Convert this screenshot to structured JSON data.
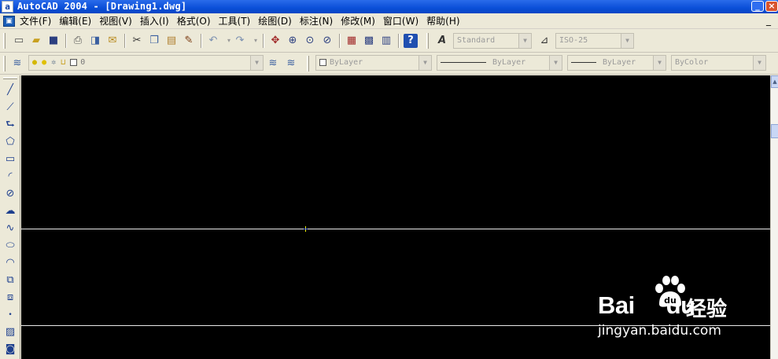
{
  "window": {
    "title": "AutoCAD 2004 - [Drawing1.dwg]",
    "app_icon": "autocad-icon",
    "buttons": {
      "minimize": "_",
      "close": "×"
    }
  },
  "menu": {
    "doc_icon": "document-icon",
    "items": [
      "文件(F)",
      "编辑(E)",
      "视图(V)",
      "插入(I)",
      "格式(O)",
      "工具(T)",
      "绘图(D)",
      "标注(N)",
      "修改(M)",
      "窗口(W)",
      "帮助(H)"
    ],
    "doc_minimize": "_"
  },
  "standard_toolbar": {
    "icons": [
      "new-icon",
      "open-icon",
      "save-icon",
      "print-icon",
      "preview-icon",
      "publish-icon",
      "cut-icon",
      "copy-icon",
      "paste-icon",
      "matchprop-icon",
      "undo-icon",
      "redo-icon",
      "pan-icon",
      "zoom-realtime-icon",
      "zoom-window-icon",
      "zoom-previous-icon",
      "properties-icon",
      "designcenter-icon",
      "toolpalettes-icon",
      "help-icon"
    ],
    "text_style_value": "Standard",
    "dim_style_value": "ISO-25"
  },
  "layers_toolbar": {
    "layer_value": "0",
    "color_value": "ByLayer",
    "linetype_value": "ByLayer",
    "lineweight_value": "ByLayer",
    "plotstyle_value": "ByColor"
  },
  "draw_toolbar": {
    "tools": [
      "line-icon",
      "construction-line-icon",
      "polyline-icon",
      "polygon-icon",
      "rectangle-icon",
      "arc-icon",
      "circle-icon",
      "revision-cloud-icon",
      "spline-icon",
      "ellipse-icon",
      "ellipse-arc-icon",
      "insert-block-icon",
      "make-block-icon",
      "point-icon",
      "hatch-icon",
      "region-icon"
    ]
  },
  "watermark": {
    "brand_left": "Bai",
    "brand_right": "du",
    "cn_text": "经验",
    "url": "jingyan.baidu.com"
  },
  "colors": {
    "canvas": "#000000",
    "title_bar": "#0a4fd8",
    "chrome": "#ece9d8"
  }
}
